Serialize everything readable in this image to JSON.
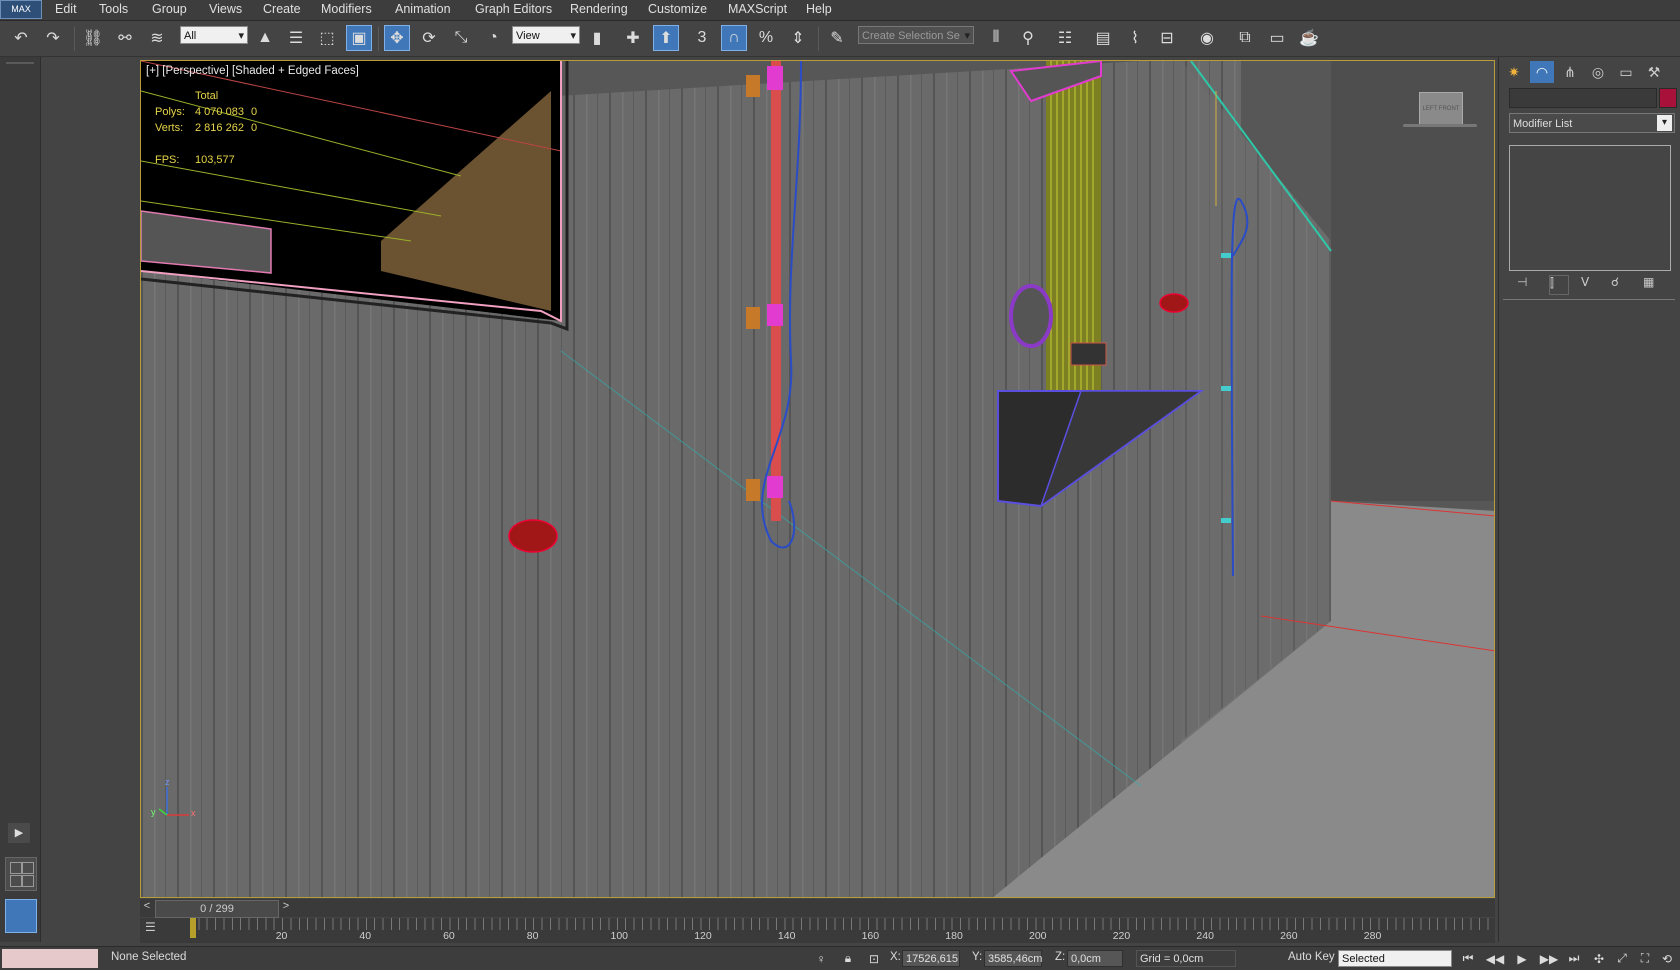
{
  "app": {
    "logo": "MAX"
  },
  "menu": {
    "items": [
      "Edit",
      "Tools",
      "Group",
      "Views",
      "Create",
      "Modifiers",
      "Animation",
      "Graph Editors",
      "Rendering",
      "Customize",
      "MAXScript",
      "Help"
    ]
  },
  "toolbar": {
    "filter_value": "All",
    "refcoord_value": "View",
    "snap_angle_label": "3",
    "selection_set_placeholder": "Create Selection Se"
  },
  "viewport": {
    "label": "[+] [Perspective] [Shaded + Edged Faces]",
    "stats": {
      "total_label": "Total",
      "polys_label": "Polys:",
      "polys_value": "4 070 083",
      "polys_sel": "0",
      "verts_label": "Verts:",
      "verts_value": "2 816 262",
      "verts_sel": "0",
      "fps_label": "FPS:",
      "fps_value": "103,577"
    },
    "viewcube_label": "LEFT FRONT",
    "axis": {
      "z": "z",
      "x": "x",
      "y": "y"
    }
  },
  "command_panel": {
    "modifier_list": "Modifier List",
    "object_color": "#a8123a"
  },
  "time_slider": {
    "label": "0 / 299",
    "prev": "<",
    "next": ">"
  },
  "trackbar": {
    "ticks": [
      "20",
      "40",
      "60",
      "80",
      "100",
      "120",
      "140",
      "160",
      "180",
      "200",
      "220",
      "240",
      "260",
      "280"
    ]
  },
  "status": {
    "selection": "None Selected",
    "x_label": "X:",
    "x_value": "17526,615",
    "y_label": "Y:",
    "y_value": "3585,46cm",
    "z_label": "Z:",
    "z_value": "0,0cm",
    "grid": "Grid = 0,0cm",
    "auto_key": "Auto Key",
    "key_mode": "Selected"
  },
  "colors": {
    "viewport_border": "#b89b3a",
    "stats_text": "#e6d44a",
    "active_tool": "#3f77b8",
    "pipe_red": "#d94d4d",
    "magenta": "#e23bd0",
    "yellow_pipe": "#b7bd2a"
  }
}
